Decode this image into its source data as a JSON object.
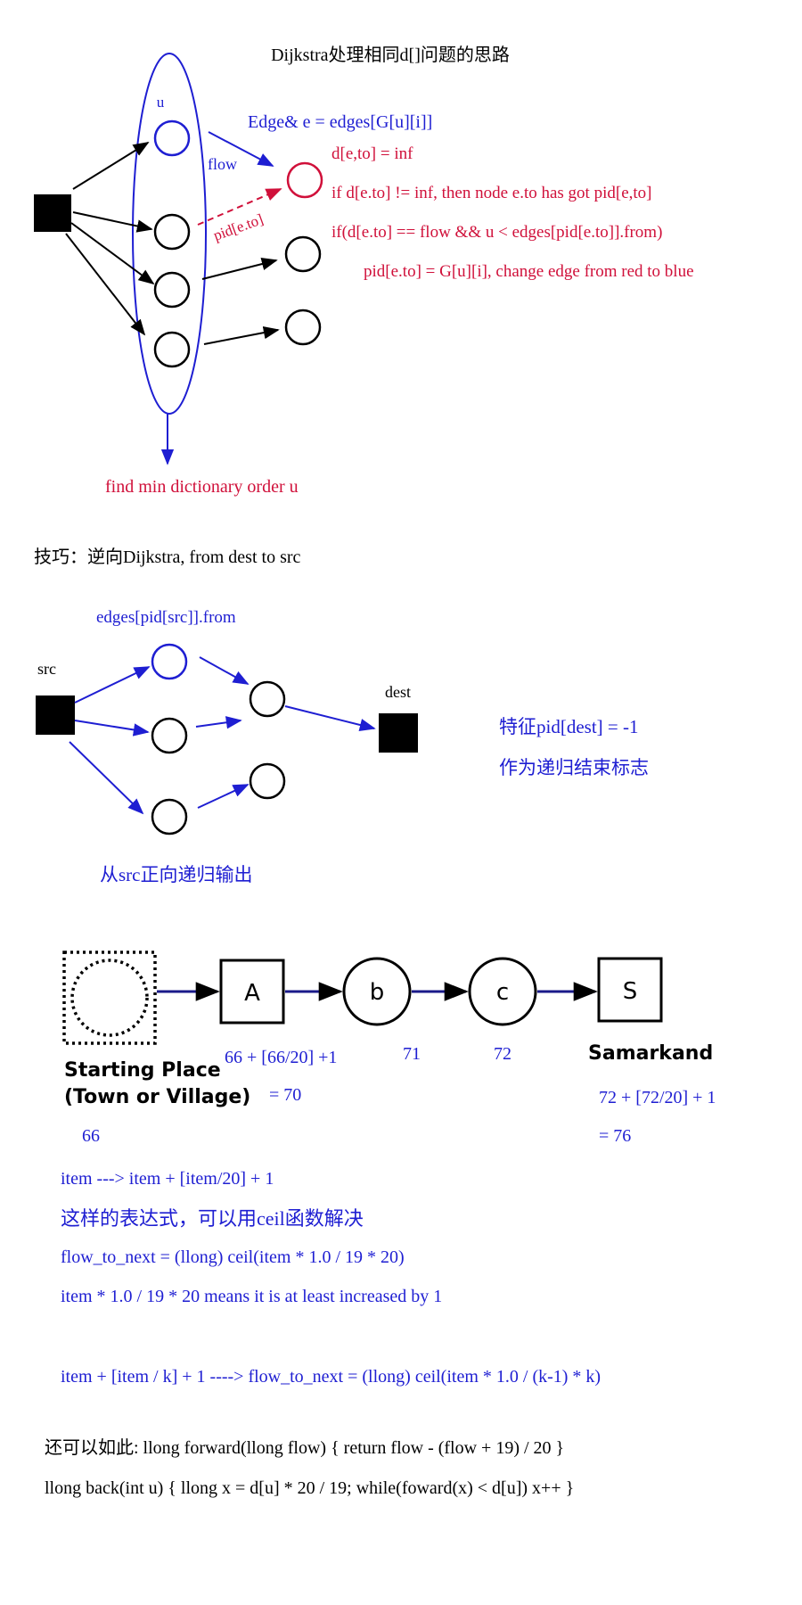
{
  "colors": {
    "blue": "#1e1ed2",
    "red": "#d0103a",
    "black": "#000000",
    "navy": "#1a1a8a"
  },
  "diagram1": {
    "title": "Dijkstra处理相同d[]问题的思路",
    "u_label": "u",
    "flow_label": "flow",
    "pid_label": "pid[e.to]",
    "edge_decl": "Edge& e = edges[G[u][i]]",
    "red_lines": [
      "d[e,to] = inf",
      "if d[e.to] != inf, then node e.to has got pid[e,to]",
      "if(d[e.to] == flow && u < edges[pid[e.to]].from)",
      "pid[e.to] = G[u][i], change edge from red to blue"
    ],
    "find_min": "find min dictionary order u"
  },
  "trick": "技巧：逆向Dijkstra, from dest to src",
  "diagram2": {
    "edges_label": "edges[pid[src]].from",
    "src_label": "src",
    "dest_label": "dest",
    "feature_line1": "特征pid[dest] = -1",
    "feature_line2": "作为递归结束标志",
    "forward_output": "从src正向递归输出"
  },
  "diagram3": {
    "node_a": "A",
    "node_b": "b",
    "node_c": "c",
    "node_s": "S",
    "starting_place_1": "Starting Place",
    "starting_place_2": "(Town or Village)",
    "samarkand": "Samarkand",
    "calc_a": "66 + [66/20] +1",
    "calc_a_result": "= 70",
    "val_b": "71",
    "val_c": "72",
    "val_start": "66",
    "calc_s": "72 + [72/20] + 1",
    "calc_s_result": "= 76"
  },
  "formulas": [
    "item --->  item + [item/20] + 1",
    "这样的表达式，可以用ceil函数解决",
    "flow_to_next = (llong) ceil(item * 1.0 / 19 * 20)",
    "item * 1.0 / 19 * 20 means it is at least increased by 1",
    "item + [item / k] + 1   ---->  flow_to_next = (llong) ceil(item * 1.0 / (k-1) * k)"
  ],
  "bottom": [
    "还可以如此: llong forward(llong flow) { return flow - (flow + 19) / 20 }",
    "llong back(int u) { llong x = d[u] * 20 / 19;  while(foward(x) < d[u])   x++  }"
  ]
}
